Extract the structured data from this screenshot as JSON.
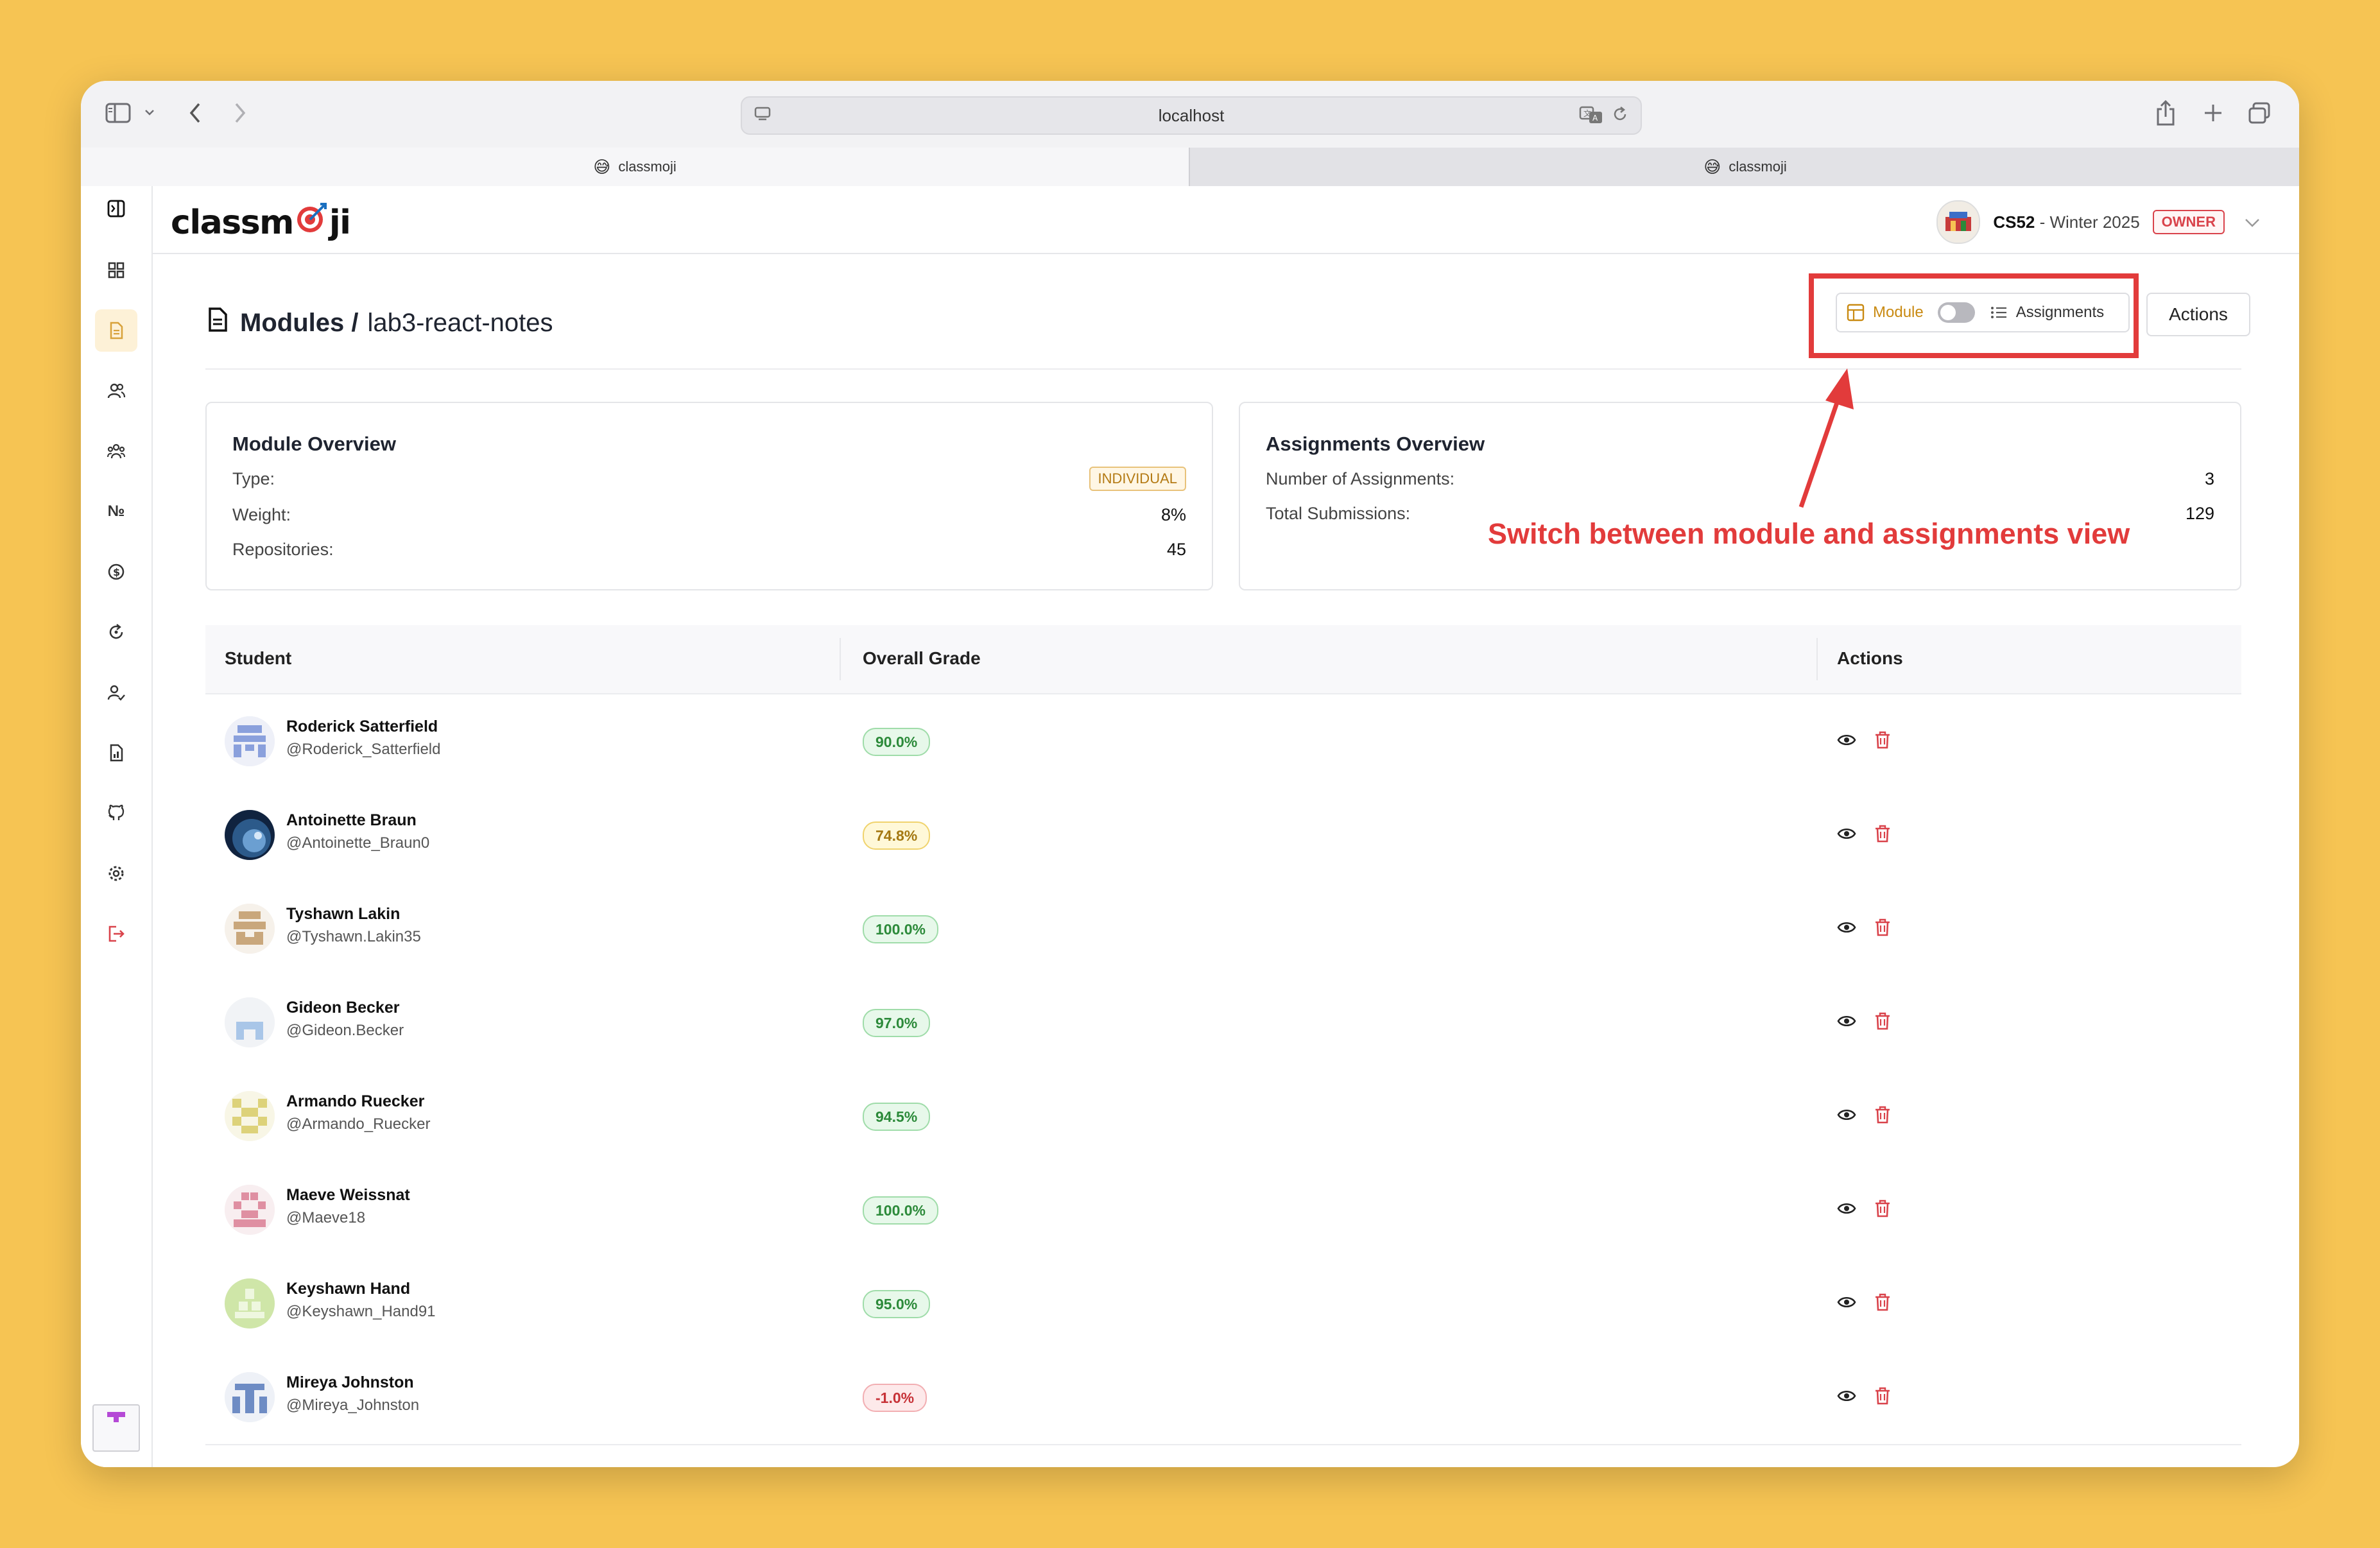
{
  "browser": {
    "url": "localhost",
    "tabs": [
      {
        "label": "classmoji",
        "icon": "grinning-sweat-emoji"
      },
      {
        "label": "classmoji",
        "icon": "grinning-sweat-emoji"
      }
    ]
  },
  "app": {
    "logo_left": "classm",
    "logo_right": "ji",
    "course": {
      "code": "CS52",
      "term": " - Winter 2025",
      "role": "OWNER"
    }
  },
  "page": {
    "breadcrumb_root": "Modules /",
    "breadcrumb_current": "lab3-react-notes",
    "view_toggle": {
      "module_label": "Module",
      "assignments_label": "Assignments",
      "state": "module"
    },
    "actions_label": "Actions"
  },
  "module_overview": {
    "title": "Module Overview",
    "type_label": "Type:",
    "type_value": "INDIVIDUAL",
    "weight_label": "Weight:",
    "weight_value": "8%",
    "repos_label": "Repositories:",
    "repos_value": "45"
  },
  "assignments_overview": {
    "title": "Assignments Overview",
    "count_label": "Number of Assignments:",
    "count_value": "3",
    "subs_label": "Total Submissions:",
    "subs_value": "129"
  },
  "annotation": {
    "text": "Switch between module and assignments view",
    "color": "#e23b3b"
  },
  "table": {
    "headers": {
      "student": "Student",
      "grade": "Overall Grade",
      "actions": "Actions"
    },
    "rows": [
      {
        "name": "Roderick Satterfield",
        "handle": "@Roderick_Satterfield",
        "grade": "90.0%",
        "tone": "green"
      },
      {
        "name": "Antoinette Braun",
        "handle": "@Antoinette_Braun0",
        "grade": "74.8%",
        "tone": "yellow"
      },
      {
        "name": "Tyshawn Lakin",
        "handle": "@Tyshawn.Lakin35",
        "grade": "100.0%",
        "tone": "green"
      },
      {
        "name": "Gideon Becker",
        "handle": "@Gideon.Becker",
        "grade": "97.0%",
        "tone": "green"
      },
      {
        "name": "Armando Ruecker",
        "handle": "@Armando_Ruecker",
        "grade": "94.5%",
        "tone": "green"
      },
      {
        "name": "Maeve Weissnat",
        "handle": "@Maeve18",
        "grade": "100.0%",
        "tone": "green"
      },
      {
        "name": "Keyshawn Hand",
        "handle": "@Keyshawn_Hand91",
        "grade": "95.0%",
        "tone": "green"
      },
      {
        "name": "Mireya Johnston",
        "handle": "@Mireya_Johnston",
        "grade": "-1.0%",
        "tone": "red"
      }
    ]
  },
  "colors": {
    "accent": "#d8a23a",
    "danger": "#d9434b",
    "background": "#F6C453"
  }
}
